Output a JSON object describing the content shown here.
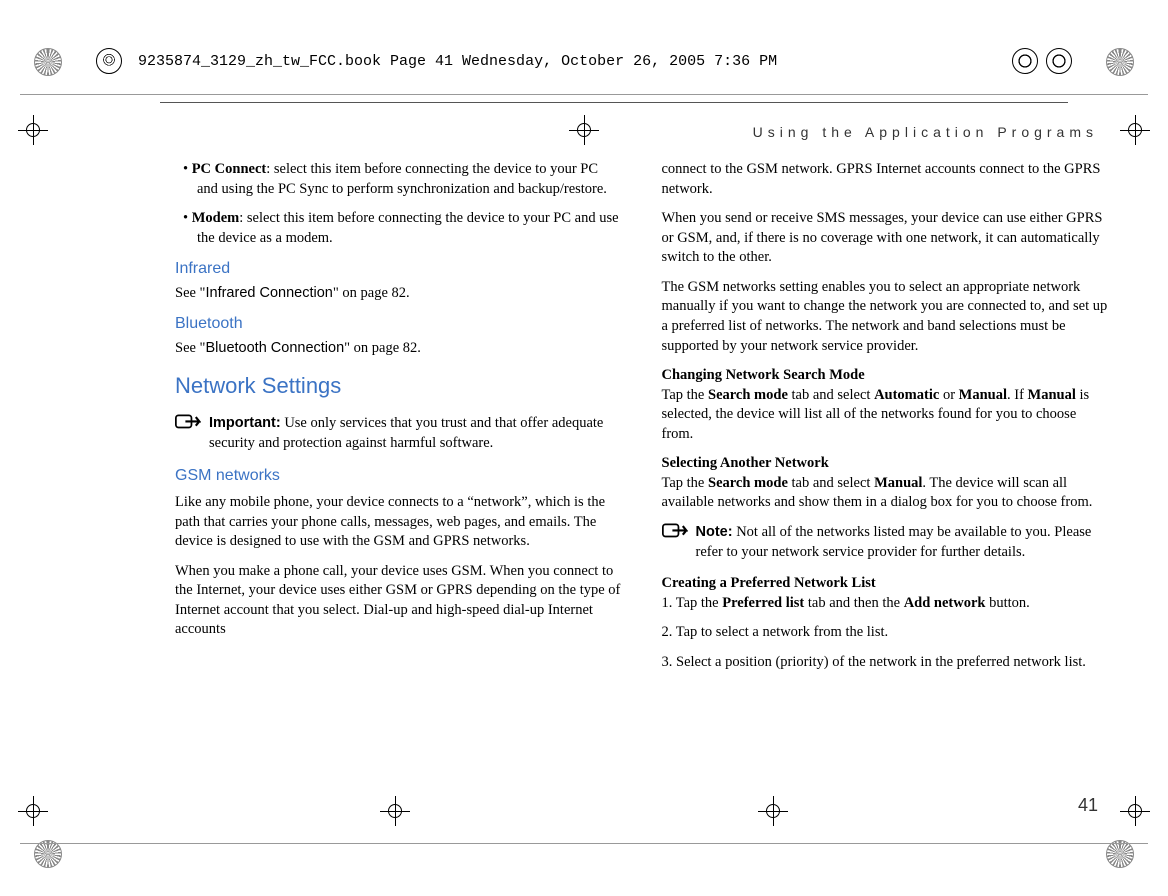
{
  "header": {
    "meta_line": "9235874_3129_zh_tw_FCC.book  Page 41  Wednesday, October 26, 2005  7:36 PM",
    "running_head": "Using the Application Programs"
  },
  "page_number": "41",
  "col1": {
    "bullet1_label": "PC Connect",
    "bullet1_text": ": select this item before connecting the device to your PC and using the PC Sync to perform synchronization and backup/restore.",
    "bullet2_label": "Modem",
    "bullet2_text": ": select this item before connecting the device to your PC and use the device as a modem.",
    "infrared_h": "Infrared",
    "infrared_see": "See \"",
    "infrared_ref": "Infrared Connection",
    "infrared_after": "\" on page 82.",
    "bluetooth_h": "Bluetooth",
    "bluetooth_see": "See \"",
    "bluetooth_ref": "Bluetooth Connection",
    "bluetooth_after": "\" on page 82.",
    "network_h1": "Network Settings",
    "important_label": "Important:",
    "important_text": " Use only services that you trust and that offer adequate security and protection against harmful software.",
    "gsm_h": "GSM networks",
    "gsm_p1": "Like any mobile phone, your device connects to a “network”, which is the path that carries your phone calls, messages, web pages, and emails. The device is designed to use with the GSM and GPRS networks.",
    "gsm_p2": "When you make a phone call, your device uses GSM. When you connect to the Internet, your device uses either GSM or GPRS depending on the type of Internet account that you select. Dial-up and high-speed dial-up Internet accounts"
  },
  "col2": {
    "gsm_p2_cont": "connect to the GSM network. GPRS Internet accounts connect to the GPRS network.",
    "p3": "When you send or receive SMS messages, your device can use either GPRS or GSM, and, if there is no coverage with one network, it can automatically switch to the other.",
    "p4": "The GSM networks setting enables you to select an appropriate network manually if you want to change the network you are connected to, and set up a preferred list of networks. The network and band selections must be supported by your network service provider.",
    "changing_h": "Changing Network Search Mode",
    "changing_p_pre": "Tap the ",
    "changing_bold1": "Search mode",
    "changing_mid1": " tab and select ",
    "changing_bold2": "Automatic",
    "changing_mid2": " or ",
    "changing_bold3": "Manual",
    "changing_mid3": ". If ",
    "changing_bold4": "Manual",
    "changing_after": " is selected, the device will list all of the networks found for you to choose from.",
    "selecting_h": "Selecting Another Network",
    "selecting_pre": "Tap the ",
    "selecting_bold1": "Search mode",
    "selecting_mid": " tab and select ",
    "selecting_bold2": "Manual",
    "selecting_after": ". The device will scan all available networks and show them in a dialog box for you to choose from.",
    "note_label": "Note:",
    "note_text": " Not all of the networks listed may be available to you. Please refer to your network service provider for further details.",
    "creating_h": "Creating a Preferred Network List",
    "step1_pre": "1. Tap the ",
    "step1_bold1": "Preferred list",
    "step1_mid": " tab and then the ",
    "step1_bold2": "Add network",
    "step1_after": " button.",
    "step2": "2. Tap to select a network from the list.",
    "step3": "3. Select a position (priority) of the network in the preferred network list."
  }
}
